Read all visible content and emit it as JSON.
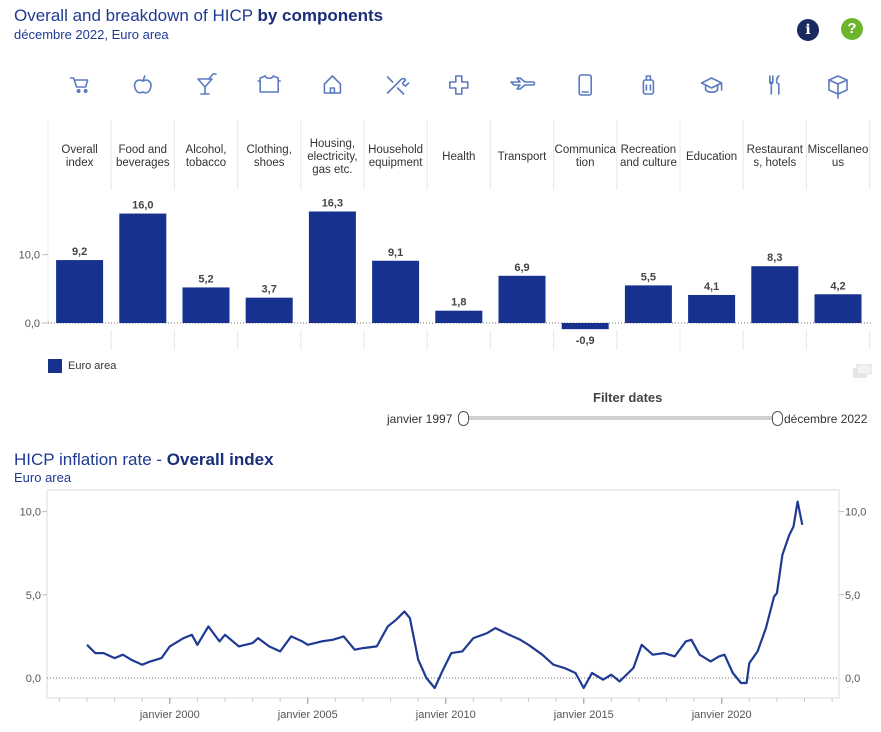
{
  "header": {
    "title_main": "Overall and breakdown of HICP ",
    "title_bold": "by components",
    "subtitle": "décembre 2022, Euro area",
    "info_icon": "info-icon",
    "help_icon": "help-icon"
  },
  "chart2_header": {
    "title_main": "HICP inflation rate - ",
    "title_bold": "Overall index",
    "subtitle": "Euro area"
  },
  "filter": {
    "label": "Filter dates",
    "start": "janvier 1997",
    "end": "décembre 2022"
  },
  "legend": {
    "label": "Euro area"
  },
  "colors": {
    "bar": "#17318f",
    "line": "#1f3a93",
    "icon": "#5b7bc0"
  },
  "chart_data": [
    {
      "type": "bar",
      "categories": [
        [
          "Overall",
          "index"
        ],
        [
          "Food and",
          "beverages"
        ],
        [
          "Alcohol,",
          "tobacco"
        ],
        [
          "Clothing,",
          "shoes"
        ],
        [
          "Housing,",
          "electricity,",
          "gas etc."
        ],
        [
          "Household",
          "equipment"
        ],
        [
          "Health"
        ],
        [
          "Transport"
        ],
        [
          "Communica",
          "tion"
        ],
        [
          "Recreation",
          "and culture"
        ],
        [
          "Education"
        ],
        [
          "Restaurant",
          "s, hotels"
        ],
        [
          "Miscellaneo",
          "us"
        ]
      ],
      "icons": [
        "cart-icon",
        "apple-icon",
        "cocktail-icon",
        "shirt-icon",
        "house-icon",
        "tools-icon",
        "health-cross-icon",
        "plane-icon",
        "phone-icon",
        "luggage-icon",
        "graduation-cap-icon",
        "cutlery-icon",
        "box-icon"
      ],
      "series": [
        {
          "name": "Euro area",
          "values": [
            9.2,
            16.0,
            5.2,
            3.7,
            16.3,
            9.1,
            1.8,
            6.9,
            -0.9,
            5.5,
            4.1,
            8.3,
            4.2
          ],
          "labels": [
            "9,2",
            "16,0",
            "5,2",
            "3,7",
            "16,3",
            "9,1",
            "1,8",
            "6,9",
            "-0,9",
            "5,5",
            "4,1",
            "8,3",
            "4,2"
          ]
        }
      ],
      "ytick_values": [
        0,
        10
      ],
      "ytick_labels": [
        "0,0",
        "10,0"
      ],
      "ylim": [
        -2.3,
        20
      ]
    },
    {
      "type": "line",
      "series_name": "Euro area",
      "xlim": [
        1995.55,
        2024.25
      ],
      "ylim": [
        -1.2,
        11.3
      ],
      "xticks": [
        {
          "value": 2000.0,
          "label": "janvier 2000"
        },
        {
          "value": 2005.0,
          "label": "janvier 2005"
        },
        {
          "value": 2010.0,
          "label": "janvier 2010"
        },
        {
          "value": 2015.0,
          "label": "janvier 2015"
        },
        {
          "value": 2020.0,
          "label": "janvier 2020"
        }
      ],
      "yticks": [
        {
          "value": 0,
          "label": "0,0"
        },
        {
          "value": 5,
          "label": "5,0"
        },
        {
          "value": 10,
          "label": "10,0"
        }
      ],
      "points": [
        [
          1997.0,
          2.0
        ],
        [
          1997.3,
          1.5
        ],
        [
          1997.6,
          1.5
        ],
        [
          1998.0,
          1.2
        ],
        [
          1998.3,
          1.4
        ],
        [
          1998.6,
          1.1
        ],
        [
          1999.0,
          0.8
        ],
        [
          1999.3,
          1.0
        ],
        [
          1999.7,
          1.2
        ],
        [
          2000.0,
          1.9
        ],
        [
          2000.5,
          2.4
        ],
        [
          2000.8,
          2.6
        ],
        [
          2001.0,
          2.0
        ],
        [
          2001.4,
          3.1
        ],
        [
          2001.8,
          2.2
        ],
        [
          2002.0,
          2.6
        ],
        [
          2002.5,
          1.9
        ],
        [
          2003.0,
          2.1
        ],
        [
          2003.2,
          2.4
        ],
        [
          2003.6,
          1.9
        ],
        [
          2004.0,
          1.6
        ],
        [
          2004.4,
          2.5
        ],
        [
          2004.8,
          2.2
        ],
        [
          2005.0,
          2.0
        ],
        [
          2005.5,
          2.2
        ],
        [
          2005.9,
          2.3
        ],
        [
          2006.3,
          2.5
        ],
        [
          2006.7,
          1.7
        ],
        [
          2007.0,
          1.8
        ],
        [
          2007.5,
          1.9
        ],
        [
          2007.9,
          3.1
        ],
        [
          2008.2,
          3.5
        ],
        [
          2008.5,
          4.0
        ],
        [
          2008.7,
          3.6
        ],
        [
          2009.0,
          1.1
        ],
        [
          2009.3,
          0.0
        ],
        [
          2009.6,
          -0.6
        ],
        [
          2009.9,
          0.5
        ],
        [
          2010.2,
          1.5
        ],
        [
          2010.6,
          1.6
        ],
        [
          2011.0,
          2.4
        ],
        [
          2011.5,
          2.7
        ],
        [
          2011.8,
          3.0
        ],
        [
          2012.3,
          2.6
        ],
        [
          2012.7,
          2.3
        ],
        [
          2013.0,
          2.0
        ],
        [
          2013.5,
          1.4
        ],
        [
          2013.9,
          0.8
        ],
        [
          2014.3,
          0.6
        ],
        [
          2014.7,
          0.3
        ],
        [
          2015.0,
          -0.6
        ],
        [
          2015.3,
          0.3
        ],
        [
          2015.7,
          -0.1
        ],
        [
          2016.0,
          0.2
        ],
        [
          2016.3,
          -0.2
        ],
        [
          2016.8,
          0.6
        ],
        [
          2017.1,
          2.0
        ],
        [
          2017.5,
          1.4
        ],
        [
          2017.9,
          1.5
        ],
        [
          2018.3,
          1.3
        ],
        [
          2018.7,
          2.2
        ],
        [
          2018.9,
          2.3
        ],
        [
          2019.2,
          1.4
        ],
        [
          2019.6,
          1.0
        ],
        [
          2019.9,
          1.3
        ],
        [
          2020.1,
          1.4
        ],
        [
          2020.4,
          0.3
        ],
        [
          2020.7,
          -0.3
        ],
        [
          2020.9,
          -0.3
        ],
        [
          2021.0,
          0.9
        ],
        [
          2021.3,
          1.6
        ],
        [
          2021.6,
          3.0
        ],
        [
          2021.9,
          4.9
        ],
        [
          2022.0,
          5.1
        ],
        [
          2022.2,
          7.4
        ],
        [
          2022.45,
          8.6
        ],
        [
          2022.6,
          9.1
        ],
        [
          2022.75,
          10.6
        ],
        [
          2022.92,
          9.2
        ]
      ]
    }
  ]
}
